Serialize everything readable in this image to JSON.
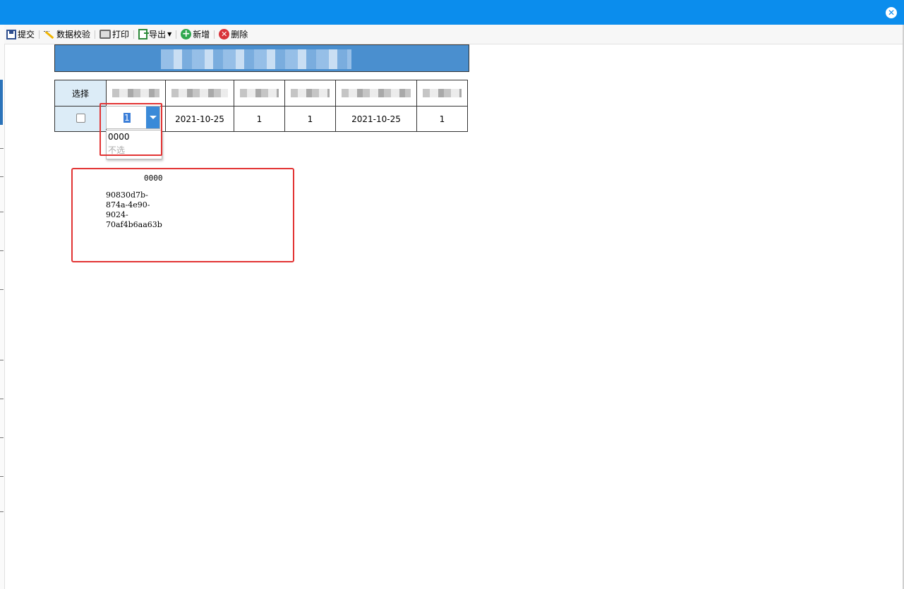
{
  "window": {
    "close_icon": "close-circle-icon"
  },
  "toolbar": {
    "items": [
      {
        "label": "提交",
        "icon": "save-icon"
      },
      {
        "label": "数据校验",
        "icon": "wand-check-icon"
      },
      {
        "label": "打印",
        "icon": "printer-icon"
      },
      {
        "label": "导出",
        "icon": "export-icon",
        "has_dropdown": true
      },
      {
        "label": "新增",
        "icon": "add-icon"
      },
      {
        "label": "删除",
        "icon": "delete-icon"
      }
    ]
  },
  "table": {
    "select_header": "选择",
    "row": {
      "combo_value": "1",
      "date1": "2021-10-25",
      "v1": "1",
      "v2": "1",
      "date2": "2021-10-25",
      "v3": "1"
    }
  },
  "dropdown": {
    "options": [
      "0000",
      "不选"
    ]
  },
  "detail": {
    "code": "0000",
    "uuid_lines": [
      "90830d7b-",
      "874a-4e90-",
      "9024-",
      "70af4b6aa63b"
    ]
  },
  "colors": {
    "titlebar": "#0b8ded",
    "accent_red": "#e23333",
    "header_blue": "#4a8fcf"
  }
}
